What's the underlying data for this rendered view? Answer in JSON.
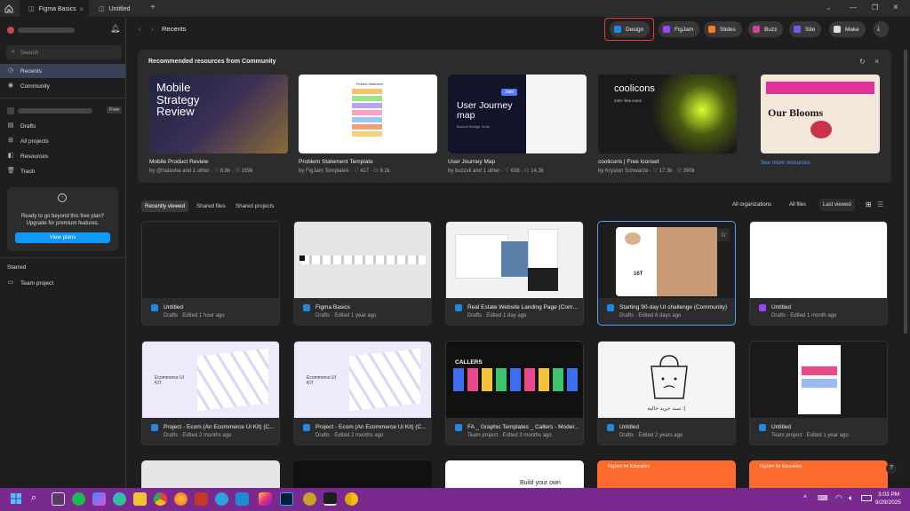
{
  "tabs": [
    {
      "label": "Figma Basics"
    },
    {
      "label": "Untitled"
    }
  ],
  "sidebar": {
    "user": "",
    "search_placeholder": "Search",
    "nav": [
      {
        "label": "Recents"
      },
      {
        "label": "Community"
      }
    ],
    "team_badge": "Free",
    "team_items": [
      {
        "label": "Drafts"
      },
      {
        "label": "All projects"
      },
      {
        "label": "Resources"
      },
      {
        "label": "Trash"
      }
    ],
    "upsell": {
      "line1": "Ready to go beyond this free plan?",
      "line2": "Upgrade for premium features.",
      "button": "View plans"
    },
    "starred_heading": "Starred",
    "starred_items": [
      {
        "label": "Team project"
      }
    ]
  },
  "header": {
    "title": "Recents"
  },
  "products": [
    {
      "label": "Design",
      "color": "#1e88e5"
    },
    {
      "label": "FigJam",
      "color": "#9747ff"
    },
    {
      "label": "Slides",
      "color": "#ff7a2f"
    },
    {
      "label": "Buzz",
      "color": "#d23fa0"
    },
    {
      "label": "Site",
      "color": "#6a5cff"
    },
    {
      "label": "Make",
      "color": "#dddddd"
    }
  ],
  "community": {
    "heading": "Recommended resources from Community",
    "see_more": "See more resources",
    "items": [
      {
        "title": "Mobile Product Review",
        "meta": "by @natasha and 1 other  ·  ♡ 8.8k  ·  ⚇ 159k",
        "thumb_text": "Mobile Strategy Review"
      },
      {
        "title": "Problem Statement Template",
        "meta": "by FigJam Templates  ·  ♡ 417  ·  ⚇ 9.2k",
        "thumb_text": "Problem Statement"
      },
      {
        "title": "User Journey Map",
        "meta": "by buzzvil and 1 other  ·  ♡ 638  ·  ⚇ 14.3k",
        "thumb_text": "User Journey map",
        "thumb_sub": "Buzzvil Design Tools",
        "thumb_tag": "Jam"
      },
      {
        "title": "coolicons | Free Iconset",
        "meta": "by Kryston Schwarze  ·  ♡ 17.3k  ·  ⚇ 390k",
        "thumb_text": "coolicons",
        "thumb_sub": "440+ free icons"
      },
      {
        "title": "",
        "meta": "",
        "thumb_text": "Our Blooms"
      }
    ]
  },
  "filters": {
    "tabs": [
      {
        "label": "Recently viewed"
      },
      {
        "label": "Shared files"
      },
      {
        "label": "Shared projects"
      }
    ],
    "org": "All organizations",
    "files": "All files",
    "sort": "Last viewed"
  },
  "files": [
    {
      "name": "Untitled",
      "meta": "Drafts · Edited 1 hour ago",
      "type": "design"
    },
    {
      "name": "Figma Basics",
      "meta": "Drafts · Edited 1 year ago",
      "type": "design"
    },
    {
      "name": "Real Estate Website Landing Page (Com...",
      "meta": "Drafts · Edited 1 day ago",
      "type": "design"
    },
    {
      "name": "Starting 90-day UI challenge (Community)",
      "meta": "Drafts · Edited 6 days ago",
      "type": "design",
      "thumb_text": "16T"
    },
    {
      "name": "Untitled",
      "meta": "Drafts · Edited 1 month ago",
      "type": "figjam"
    },
    {
      "name": "Project - Ecom (An Ecommerce Ui Kit) (C...",
      "meta": "Drafts · Edited 2 months ago",
      "type": "design",
      "thumb_text": "Ecommerce UI KIT"
    },
    {
      "name": "Project - Ecom (An Ecommerce Ui Kit) (C...",
      "meta": "Drafts · Edited 2 months ago",
      "type": "design",
      "thumb_text": "Ecommerce UI KIT"
    },
    {
      "name": "FA _ Graphic Templates _ Callers - Moder...",
      "meta": "Team project · Edited 3 months ago",
      "type": "design",
      "thumb_text": "CALLERS"
    },
    {
      "name": "Untitled",
      "meta": "Drafts · Edited 2 years ago",
      "type": "design",
      "thumb_text": "سبد خرید خالیه :("
    },
    {
      "name": "Untitled",
      "meta": "Team project · Edited 1 year ago",
      "type": "design"
    }
  ],
  "row3_texts": [
    "Build your own",
    "FigJam for Education",
    "FigJam for Education"
  ],
  "tray": {
    "time": "3:03 PM",
    "date": "9/29/2025",
    "help": "?"
  }
}
